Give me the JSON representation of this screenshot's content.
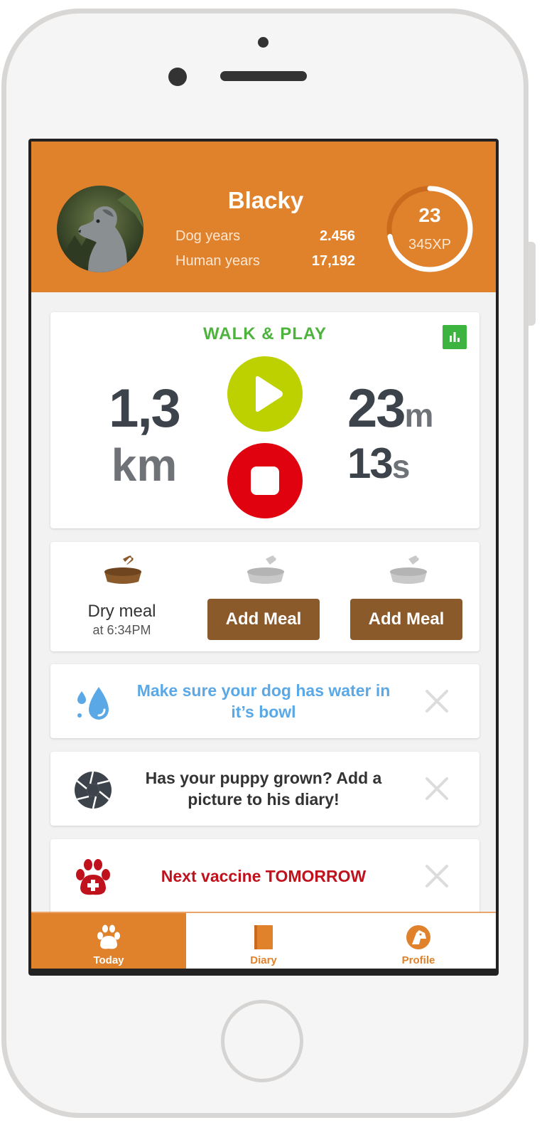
{
  "header": {
    "dog_name": "Blacky",
    "dog_years_label": "Dog years",
    "dog_years_value": "2.456",
    "human_years_label": "Human years",
    "human_years_value": "17,192",
    "level": "23",
    "xp": "345XP",
    "xp_progress": 0.72
  },
  "walk": {
    "title": "WALK & PLAY",
    "distance_value": "1,3",
    "distance_unit": "km",
    "minutes": "23",
    "minutes_unit": "m",
    "seconds": "13",
    "seconds_unit": "s"
  },
  "meals": {
    "first_name": "Dry meal",
    "first_time": "at 6:34PM",
    "add_label_1": "Add Meal",
    "add_label_2": "Add Meal"
  },
  "tips": {
    "water": "Make sure your dog has water in it’s bowl",
    "picture": "Has your puppy grown? Add a picture to his diary!",
    "vaccine": "Next vaccine TOMORROW"
  },
  "tabs": {
    "today": "Today",
    "diary": "Diary",
    "profile": "Profile"
  },
  "colors": {
    "brand_orange": "#e0812c",
    "walk_green": "#4db33d",
    "play_lime": "#bdd000",
    "stop_red": "#e0030f",
    "meal_brown": "#8b5a2b",
    "water_blue": "#5aa8e6",
    "vaccine_red": "#c0121c"
  }
}
